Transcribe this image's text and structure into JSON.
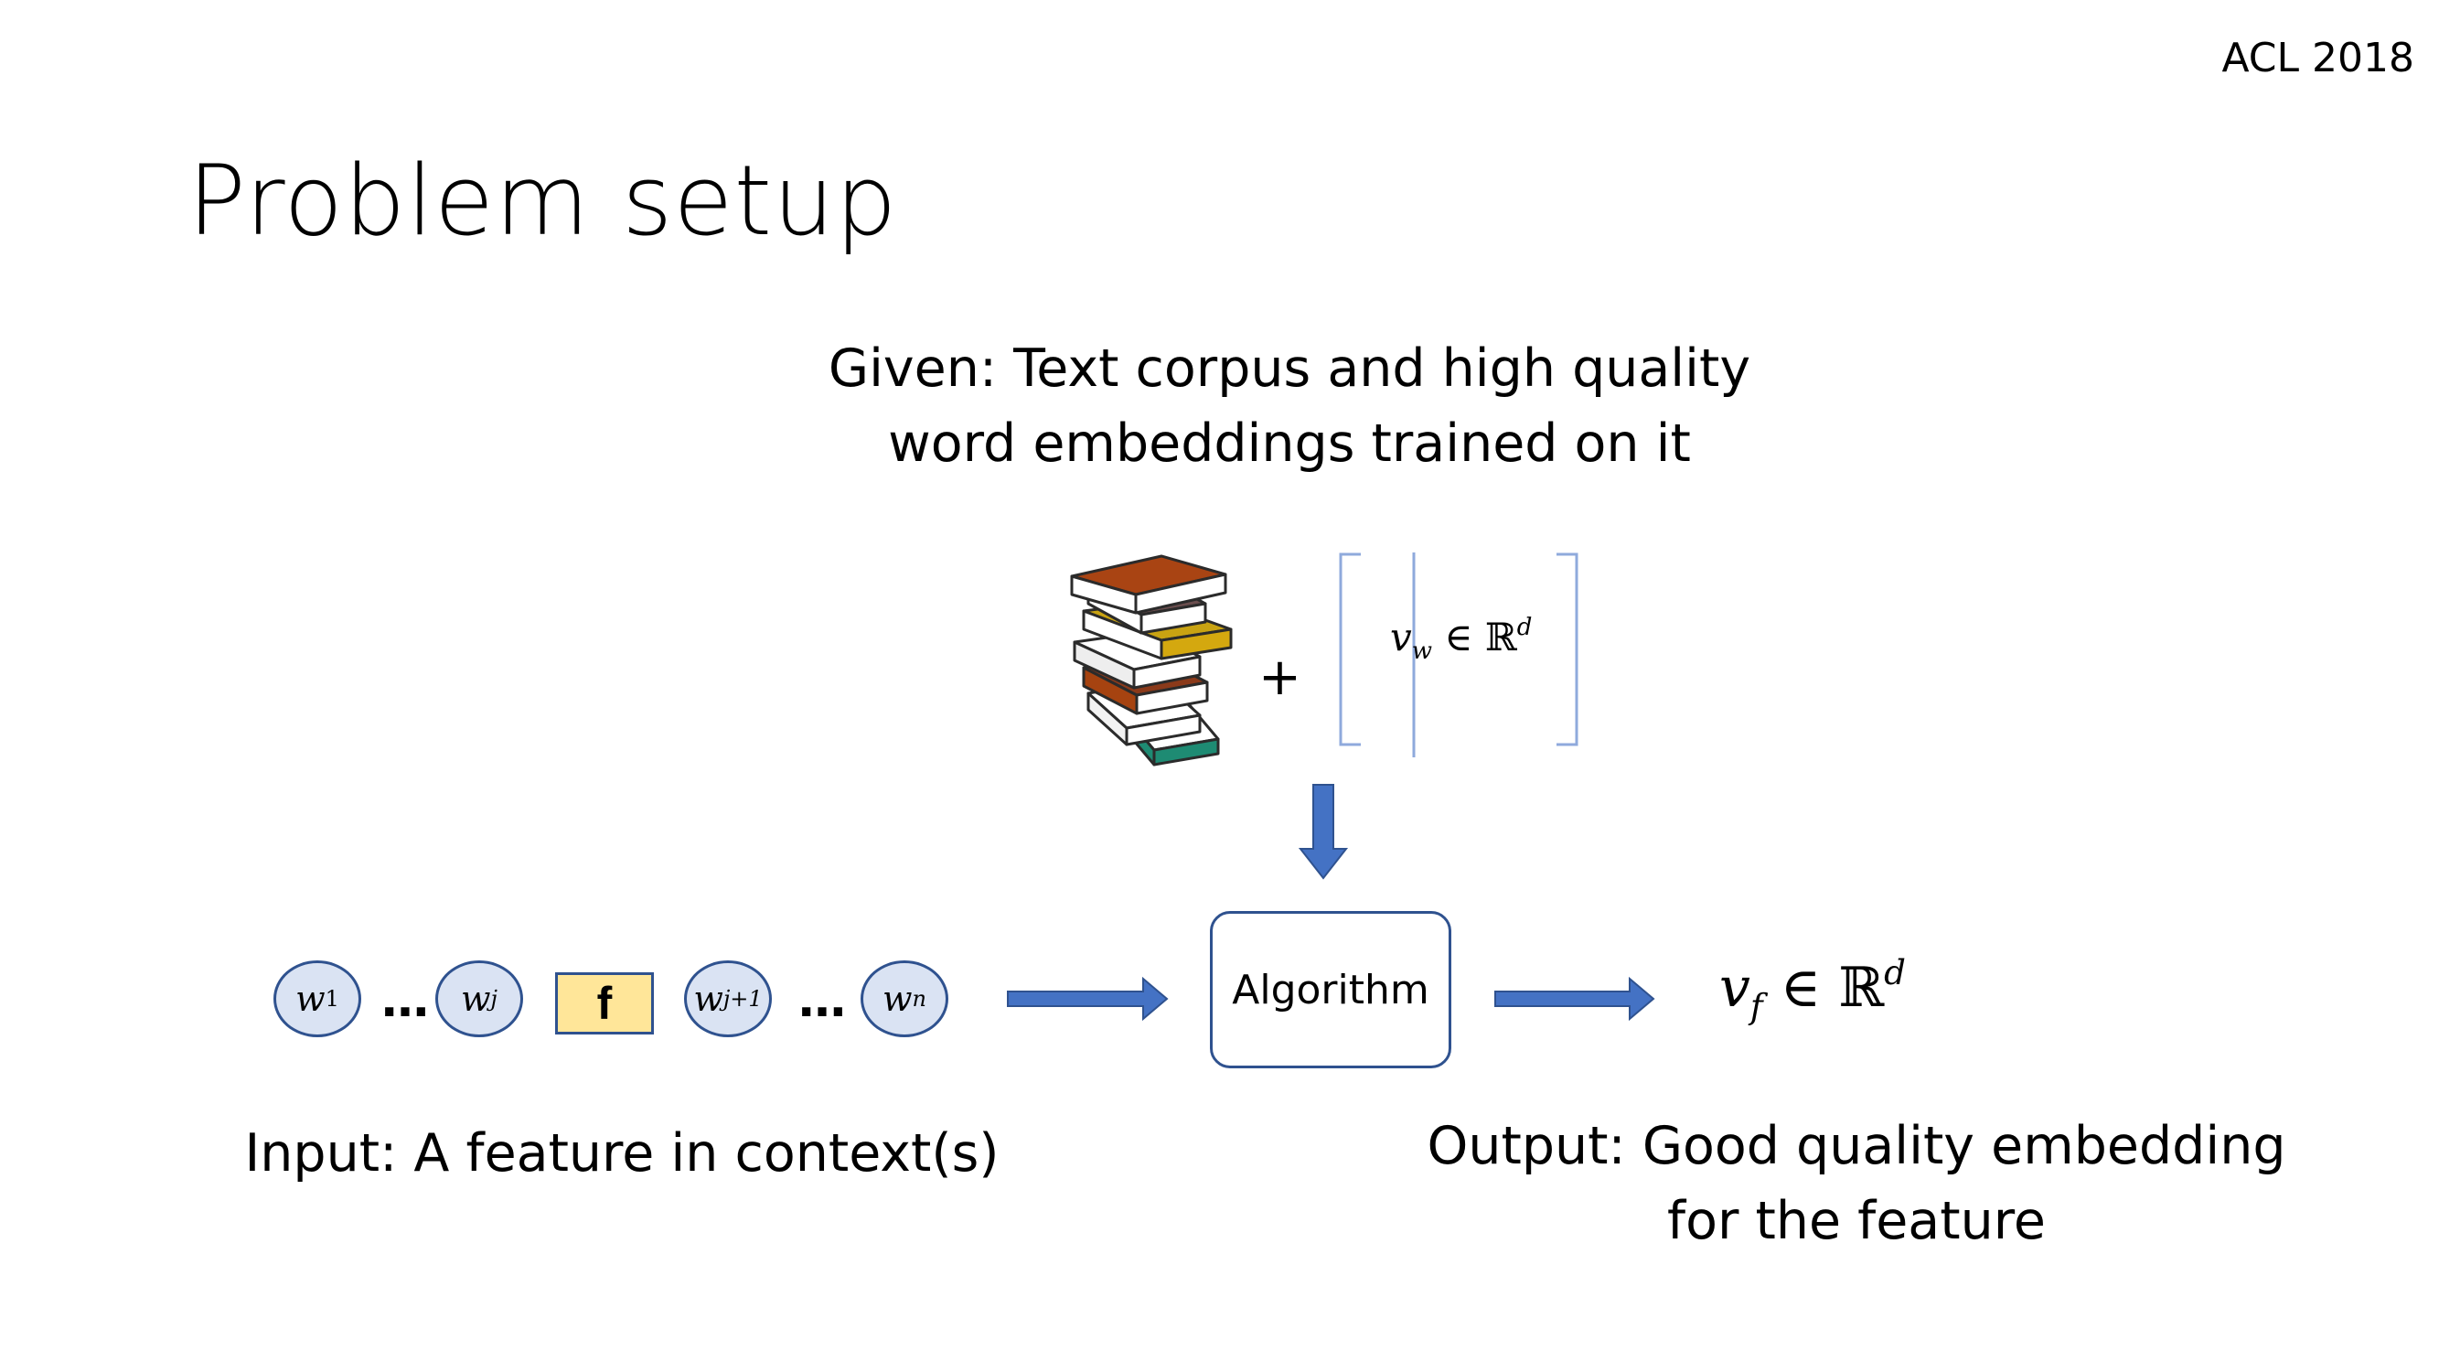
{
  "header": {
    "venue": "ACL 2018"
  },
  "slide": {
    "title": "Problem setup"
  },
  "given": {
    "line1": "Given: Text corpus and high quality",
    "line2": "word embeddings trained on it"
  },
  "diagram": {
    "plus": "+",
    "word_vector": {
      "symbol": "v",
      "subscript": "w",
      "relation": "∈",
      "space": "ℝ",
      "superscript": "d"
    },
    "tokens": [
      {
        "symbol": "w",
        "subscript": "1"
      },
      {
        "symbol": "w",
        "subscript": "j"
      },
      {
        "symbol": "w",
        "subscript": "j+1"
      },
      {
        "symbol": "w",
        "subscript": "n"
      }
    ],
    "ellipsis": "…",
    "feature": "f",
    "algorithm_label": "Algorithm",
    "output_vector": {
      "symbol": "v",
      "subscript": "f",
      "relation": "∈",
      "space": "ℝ",
      "superscript": "d"
    }
  },
  "input_caption": "Input: A feature in context(s)",
  "output_caption": {
    "line1": "Output: Good quality embedding",
    "line2": "for the feature"
  },
  "colors": {
    "arrow": "#4472c4",
    "token_fill": "#dae3f3",
    "outline": "#2f528f",
    "feature_fill": "#ffe699",
    "bracket": "#8faadc"
  }
}
